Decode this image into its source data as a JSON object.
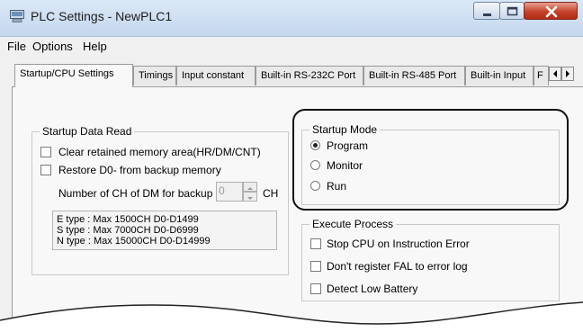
{
  "window": {
    "title": "PLC Settings - NewPLC1"
  },
  "menu": {
    "items": [
      "File",
      "Options",
      "Help"
    ]
  },
  "tabs": [
    {
      "label": "Startup/CPU Settings",
      "active": true
    },
    {
      "label": "Timings"
    },
    {
      "label": "Input constant"
    },
    {
      "label": "Built-in RS-232C Port"
    },
    {
      "label": "Built-in RS-485 Port"
    },
    {
      "label": "Built-in Input"
    },
    {
      "label": "F"
    }
  ],
  "startup_data_read": {
    "legend": "Startup Data Read",
    "clear_retained": {
      "label": "Clear retained memory area(HR/DM/CNT)",
      "checked": false
    },
    "restore_d0": {
      "label": "Restore D0- from backup memory",
      "checked": false
    },
    "backup": {
      "label": "Number of CH of DM for backup",
      "value": "0",
      "unit": "CH"
    },
    "info_lines": [
      "E type : Max 1500CH  D0-D1499",
      "S type : Max 7000CH  D0-D6999",
      "N type : Max 15000CH  D0-D14999"
    ]
  },
  "startup_mode": {
    "legend": "Startup Mode",
    "options": [
      "Program",
      "Monitor",
      "Run"
    ],
    "selected": "Program"
  },
  "execute_process": {
    "legend": "Execute Process",
    "stop_cpu": {
      "label": "Stop CPU on Instruction Error",
      "checked": false
    },
    "dont_register_fal": {
      "label": "Don't register FAL to error log",
      "checked": false
    },
    "detect_low_battery": {
      "label": "Detect Low Battery",
      "checked": false
    }
  }
}
